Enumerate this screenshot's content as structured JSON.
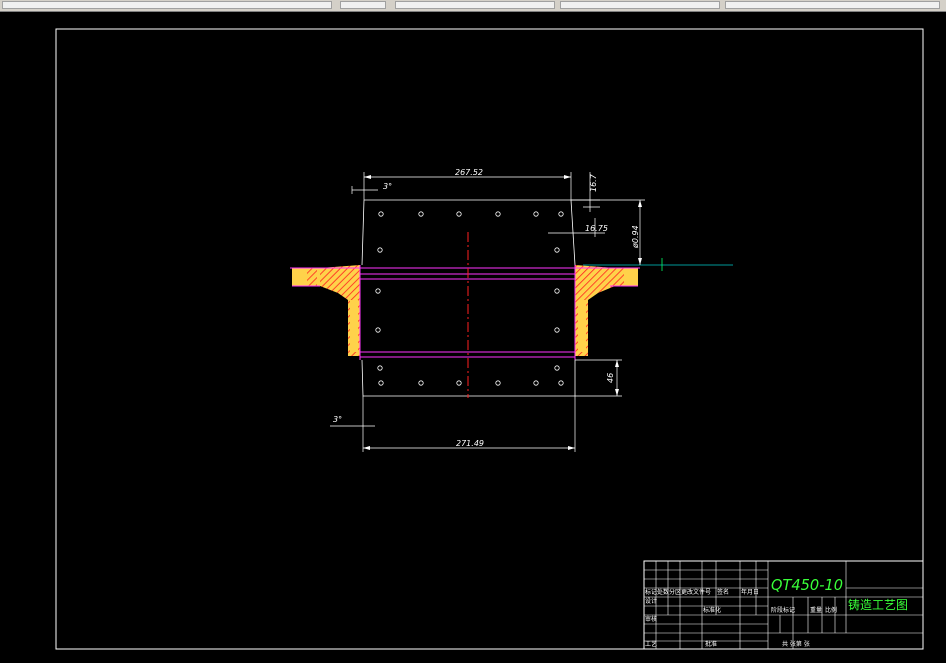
{
  "colors": {
    "background": "#000000",
    "frame": "#ffffff",
    "dimension": "#ffffff",
    "outline": "#ff33ff",
    "casting": "#ffd24a",
    "hatch": "#ff2020",
    "centerline": "#ff2020",
    "title_text": "#39ff39",
    "reference_line": "#00cccc"
  },
  "dimensions": {
    "top_width": "267.52",
    "top_angle": "3°",
    "right_top": "16.7",
    "inner_offset": "16.75",
    "diameter": "ø0.94",
    "bottom_height": "46",
    "bottom_angle": "3°",
    "bottom_width": "271.49"
  },
  "title_block": {
    "material": "QT450-10",
    "drawing_name": "铸造工艺图",
    "label_stage_mark": "阶段标记",
    "label_weight": "重量",
    "label_scale": "比例",
    "label_sheets": "共  张第  张",
    "label_designer": "设计",
    "label_check": "审核",
    "label_process": "工艺",
    "label_approve": "批准",
    "label_mark": "标记",
    "label_count": "处数",
    "label_zone": "分区",
    "label_change_doc": "更改文件号",
    "label_signature": "签名",
    "label_date": "年月日",
    "label_standard": "标准化"
  }
}
